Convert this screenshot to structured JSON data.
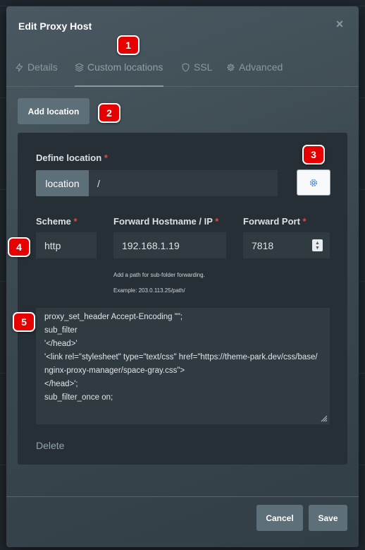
{
  "modal": {
    "title": "Edit Proxy Host",
    "close_glyph": "×"
  },
  "tabs": [
    {
      "label": "Details",
      "icon": "lightning-icon",
      "active": false
    },
    {
      "label": "Custom locations",
      "icon": "layers-icon",
      "active": true
    },
    {
      "label": "SSL",
      "icon": "shield-icon",
      "active": false
    },
    {
      "label": "Advanced",
      "icon": "gear-icon",
      "active": false
    }
  ],
  "badges": [
    "1",
    "2",
    "3",
    "4",
    "5"
  ],
  "actions": {
    "add_location": "Add location"
  },
  "location": {
    "define_label": "Define location",
    "required_marker": "*",
    "addon_label": "location",
    "path_value": "/",
    "scheme_label": "Scheme",
    "scheme_value": "http",
    "hostname_label": "Forward Hostname / IP",
    "hostname_value": "192.168.1.19",
    "hostname_help_1": "Add a path for sub-folder forwarding.",
    "hostname_help_2": "Example: 203.0.113.25/path/",
    "port_label": "Forward Port",
    "port_value": "7818",
    "config_lines": [
      "proxy_set_header Accept-Encoding \"\";",
      "sub_filter",
      "'</head>'",
      "'<link rel=\"stylesheet\" type=\"text/css\" href=\"https://theme-park.dev/css/base/",
      "nginx-proxy-manager/space-gray.css\">",
      "</head>';",
      "sub_filter_once on;"
    ],
    "delete_label": "Delete"
  },
  "footer": {
    "cancel_label": "Cancel",
    "save_label": "Save"
  },
  "colors": {
    "badge": "#e60000",
    "button": "#5d6f79",
    "panel": "#262f35",
    "required": "#e5483d",
    "accent_icon": "#3b7dd8"
  }
}
